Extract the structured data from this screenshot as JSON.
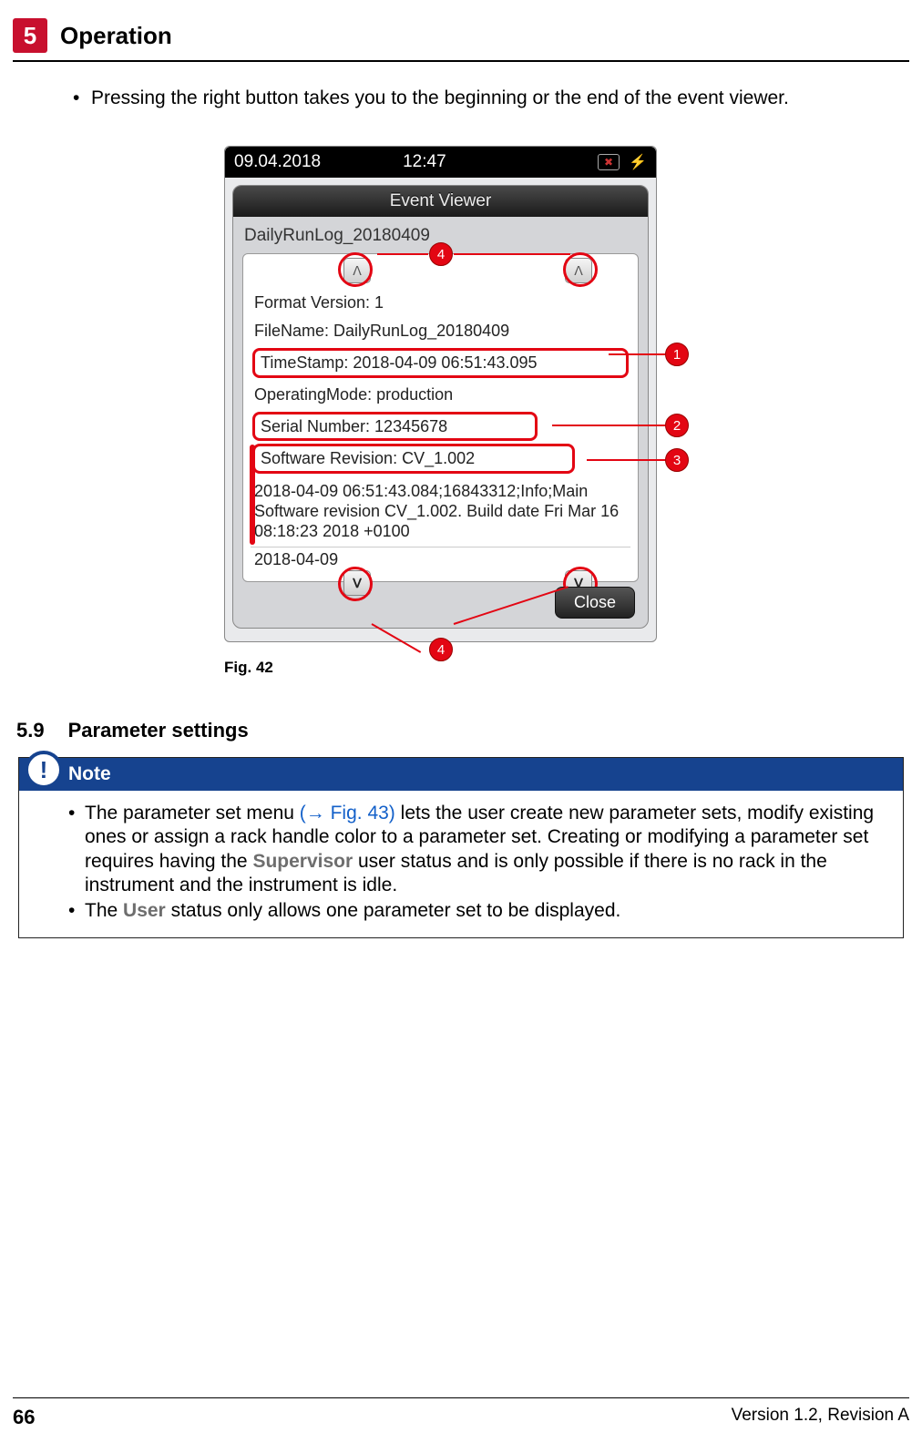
{
  "chapter": {
    "number": "5",
    "title": "Operation"
  },
  "intro_bullet": "Pressing the right button takes you to the beginning or the end of the event viewer.",
  "device": {
    "status_date": "09.04.2018",
    "status_time": "12:47",
    "window_title": "Event Viewer",
    "filename": "DailyRunLog_20180409",
    "log": {
      "format_version": "Format Version: 1",
      "file_name": "FileName: DailyRunLog_20180409",
      "timestamp": "TimeStamp: 2018-04-09 06:51:43.095",
      "operating_mode": "OperatingMode: production",
      "serial": "Serial Number: 12345678",
      "software_rev": "Software Revision: CV_1.002",
      "entry": "2018-04-09 06:51:43.084;16843312;Info;Main Software revision CV_1.002. Build date Fri Mar 16 08:18:23 2018 +0100",
      "tail": "2018-04-09"
    },
    "close_label": "Close"
  },
  "callouts": {
    "c1": "1",
    "c2": "2",
    "c3": "3",
    "c4a": "4",
    "c4b": "4"
  },
  "figure_caption": "Fig.  42",
  "section": {
    "number": "5.9",
    "title": "Parameter settings"
  },
  "note": {
    "heading": "Note",
    "bullet1_a": "The parameter set menu ",
    "bullet1_link": "(→ Fig.  43)",
    "bullet1_b": " lets the user create new parameter sets, modify existing ones or assign a rack handle color to a parameter set. Creating or modifying a parameter set requires having the ",
    "bullet1_role": "Supervisor",
    "bullet1_c": " user status and is only possible if there is no rack in the instrument and the instrument is idle.",
    "bullet2_a": "The ",
    "bullet2_role": "User",
    "bullet2_b": " status only allows one parameter set to be displayed."
  },
  "footer": {
    "page": "66",
    "version": "Version 1.2, Revision A"
  }
}
